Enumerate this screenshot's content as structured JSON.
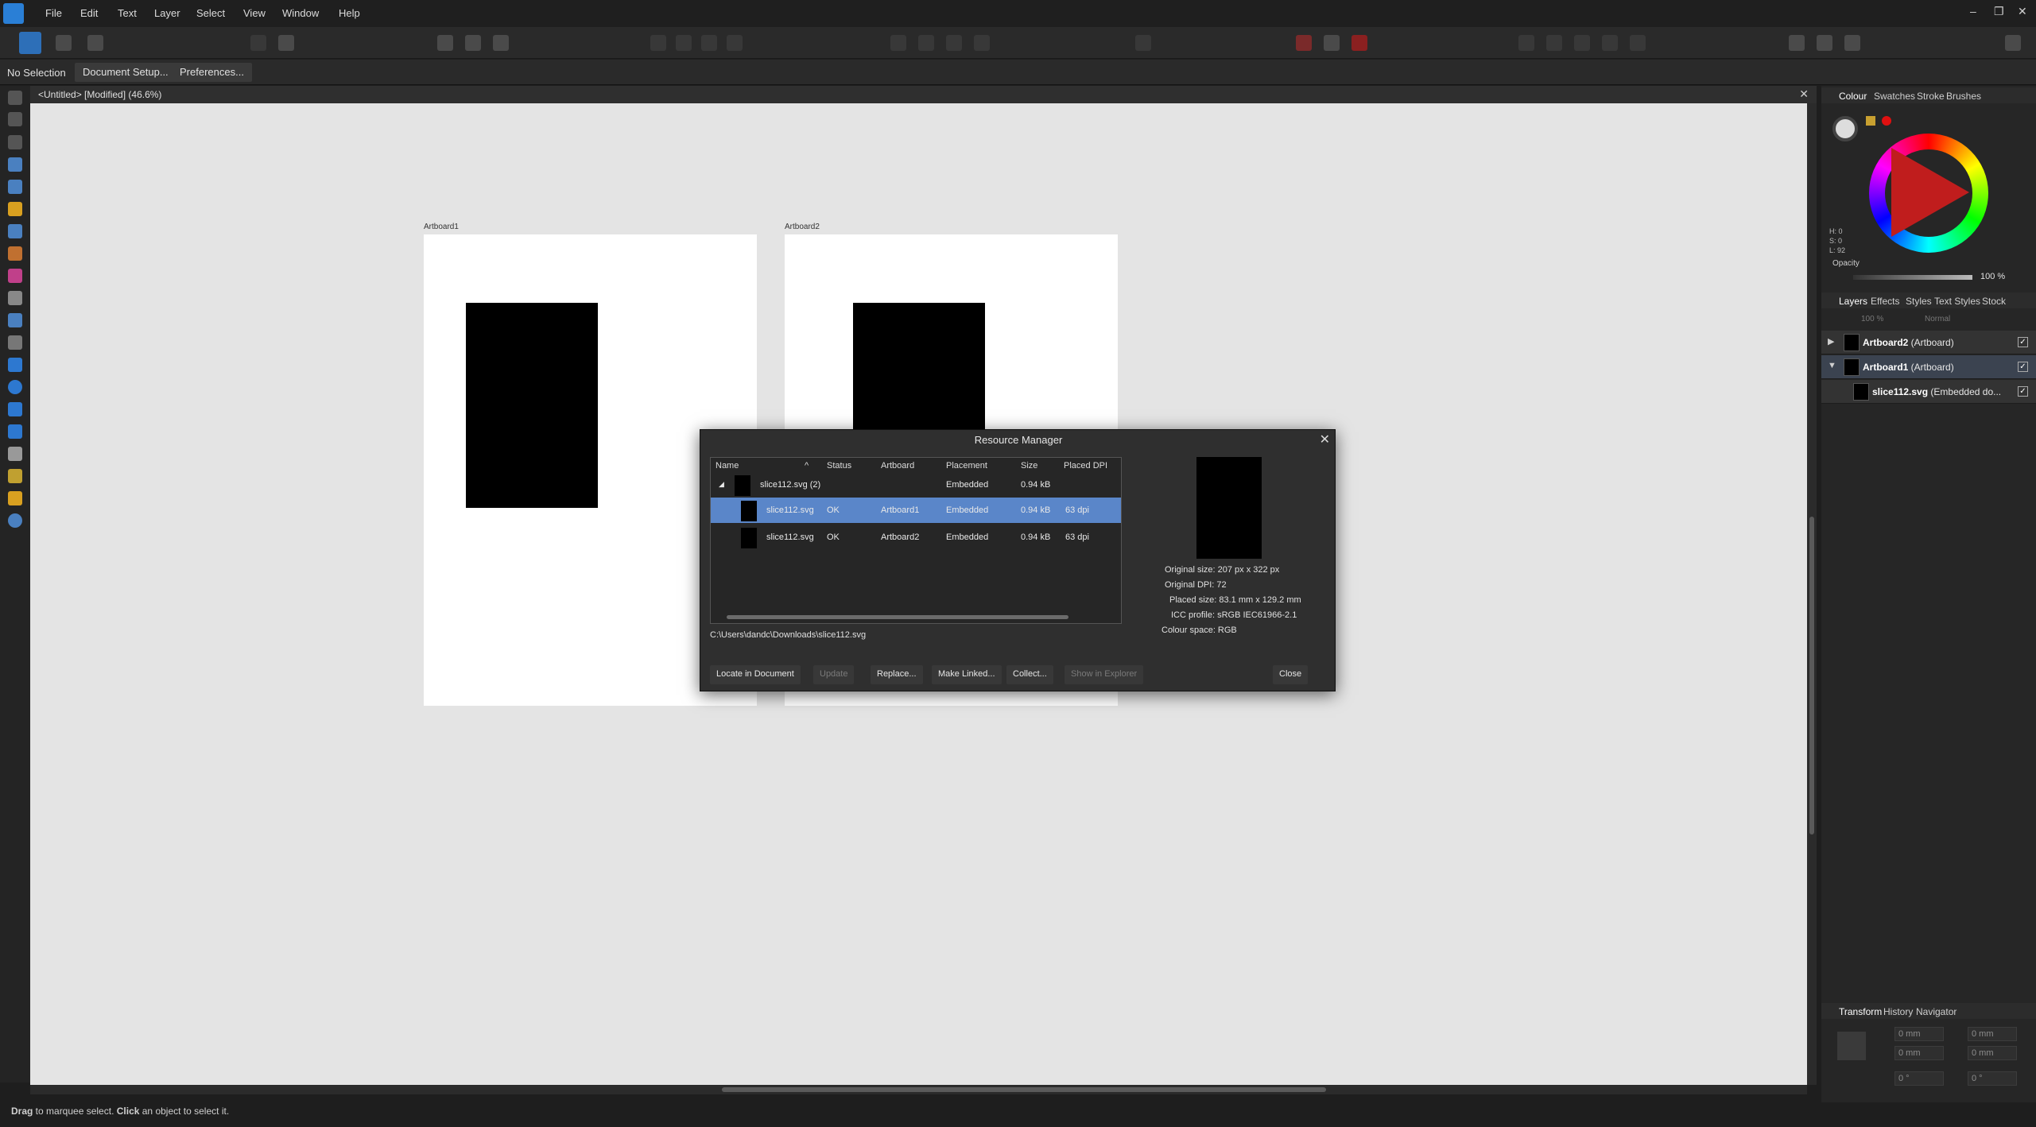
{
  "menu": [
    "File",
    "Edit",
    "Text",
    "Layer",
    "Select",
    "View",
    "Window",
    "Help"
  ],
  "context": {
    "selection": "No Selection",
    "document_setup": "Document Setup...",
    "preferences": "Preferences..."
  },
  "document": {
    "title": "<Untitled> [Modified] (46.6%)",
    "artboards": [
      "Artboard1",
      "Artboard2"
    ]
  },
  "status": {
    "drag": "Drag",
    "text1": " to marquee select. ",
    "click": "Click",
    "text2": " an object to select it."
  },
  "right_panel": {
    "colour_tabs": [
      "Colour",
      "Swatches",
      "Stroke",
      "Brushes"
    ],
    "hsl": [
      "H: 0",
      "S: 0",
      "L: 92"
    ],
    "opacity_label": "Opacity",
    "opacity_value": "100 %",
    "opacity_level": 1.0,
    "layer_tabs": [
      "Layers",
      "Effects",
      "Styles",
      "Text Styles",
      "Stock"
    ],
    "layer_opacity": "100 %",
    "blend_mode": "Normal",
    "layers": [
      {
        "name": "Artboard2",
        "type": " (Artboard)"
      },
      {
        "name": "Artboard1",
        "type": " (Artboard)"
      },
      {
        "name": "slice112.svg",
        "type": " (Embedded do..."
      }
    ],
    "transform_tabs": [
      "Transform",
      "History",
      "Navigator"
    ],
    "transform_fields": [
      "0 mm",
      "0 mm",
      "0 mm",
      "0 mm",
      "0 °",
      "0 °"
    ]
  },
  "dialog": {
    "title": "Resource Manager",
    "columns": [
      "Name",
      "Status",
      "Artboard",
      "Placement",
      "Size",
      "Placed DPI"
    ],
    "group": {
      "name": "slice112.svg (2)",
      "placement": "Embedded",
      "size": "0.94 kB"
    },
    "rows": [
      {
        "name": "slice112.svg",
        "status": "OK",
        "artboard": "Artboard1",
        "placement": "Embedded",
        "size": "0.94 kB",
        "dpi": "63 dpi"
      },
      {
        "name": "slice112.svg",
        "status": "OK",
        "artboard": "Artboard2",
        "placement": "Embedded",
        "size": "0.94 kB",
        "dpi": "63 dpi"
      }
    ],
    "path": "C:\\Users\\dandc\\Downloads\\slice112.svg",
    "info": {
      "original_size": "Original size: 207 px x 322 px",
      "original_dpi": "Original DPI: 72",
      "placed_size": "Placed size: 83.1 mm x 129.2 mm",
      "icc_profile": "ICC profile: sRGB IEC61966-2.1",
      "colour_space": "Colour space: RGB"
    },
    "buttons": {
      "locate": "Locate in Document",
      "update": "Update",
      "replace": "Replace...",
      "make_linked": "Make Linked...",
      "collect": "Collect...",
      "show_explorer": "Show in Explorer",
      "close": "Close"
    }
  }
}
